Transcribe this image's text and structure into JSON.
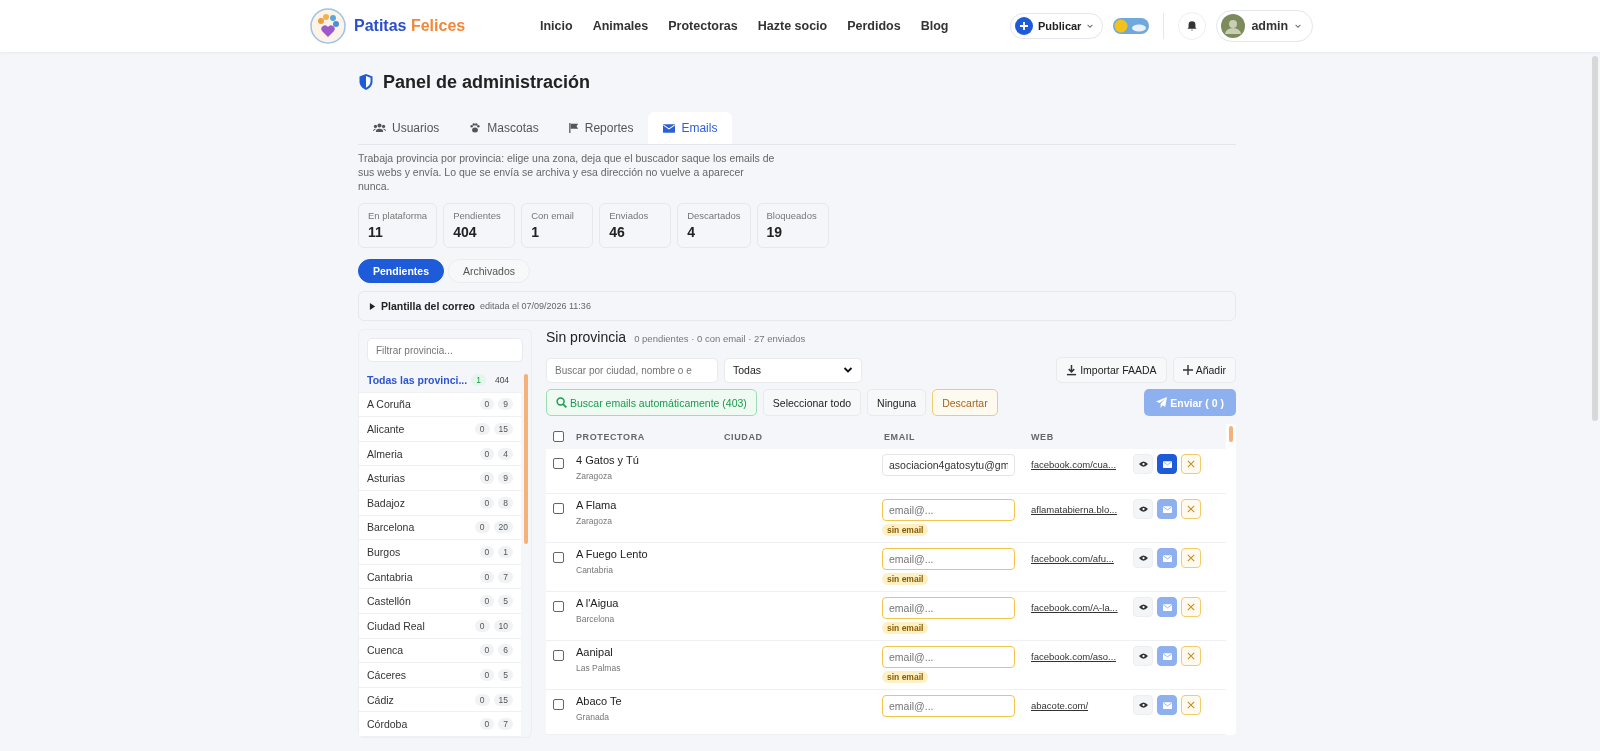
{
  "brand": {
    "first": "Patitas",
    "second": "Felices"
  },
  "nav": [
    "Inicio",
    "Animales",
    "Protectoras",
    "Hazte socio",
    "Perdidos",
    "Blog"
  ],
  "header_actions": {
    "publish": "Publicar",
    "user": "admin"
  },
  "page_title": "Panel de administración",
  "tabs": [
    {
      "label": "Usuarios",
      "kind": "users",
      "selected": false
    },
    {
      "label": "Mascotas",
      "kind": "pets",
      "selected": false
    },
    {
      "label": "Reportes",
      "kind": "reports",
      "selected": false
    },
    {
      "label": "Emails",
      "kind": "emails",
      "selected": true
    }
  ],
  "description": "Trabaja provincia por provincia: elige una zona, deja que el buscador saque los emails de sus webs y envía. Lo que se envía se archiva y esa dirección no vuelve a aparecer nunca.",
  "stats": [
    {
      "label": "En plataforma",
      "value": "11"
    },
    {
      "label": "Pendientes",
      "value": "404"
    },
    {
      "label": "Con email",
      "value": "1"
    },
    {
      "label": "Enviados",
      "value": "46"
    },
    {
      "label": "Descartados",
      "value": "4"
    },
    {
      "label": "Bloqueados",
      "value": "19"
    }
  ],
  "sub_tabs": [
    {
      "label": "Pendientes",
      "selected": true
    },
    {
      "label": "Archivados",
      "selected": false
    }
  ],
  "template": {
    "title": "Plantilla del correo",
    "meta": "editada el 07/09/2026 11:36"
  },
  "sidebar": {
    "filter_placeholder": "Filtrar provincia...",
    "items": [
      {
        "name": "Todas las provinci...",
        "with_email": "1",
        "pending": "404",
        "selected": true
      },
      {
        "name": "A Coruña",
        "with_email": "0",
        "pending": "9",
        "selected": false
      },
      {
        "name": "Alicante",
        "with_email": "0",
        "pending": "15",
        "selected": false
      },
      {
        "name": "Almeria",
        "with_email": "0",
        "pending": "4",
        "selected": false
      },
      {
        "name": "Asturias",
        "with_email": "0",
        "pending": "9",
        "selected": false
      },
      {
        "name": "Badajoz",
        "with_email": "0",
        "pending": "8",
        "selected": false
      },
      {
        "name": "Barcelona",
        "with_email": "0",
        "pending": "20",
        "selected": false
      },
      {
        "name": "Burgos",
        "with_email": "0",
        "pending": "1",
        "selected": false
      },
      {
        "name": "Cantabria",
        "with_email": "0",
        "pending": "7",
        "selected": false
      },
      {
        "name": "Castellón",
        "with_email": "0",
        "pending": "5",
        "selected": false
      },
      {
        "name": "Ciudad Real",
        "with_email": "0",
        "pending": "10",
        "selected": false
      },
      {
        "name": "Cuenca",
        "with_email": "0",
        "pending": "6",
        "selected": false
      },
      {
        "name": "Cáceres",
        "with_email": "0",
        "pending": "5",
        "selected": false
      },
      {
        "name": "Cádiz",
        "with_email": "0",
        "pending": "15",
        "selected": false
      },
      {
        "name": "Córdoba",
        "with_email": "0",
        "pending": "7",
        "selected": false
      }
    ]
  },
  "main": {
    "title": "Sin provincia",
    "summary": "0 pendientes · 0 con email · 27 enviados",
    "search_placeholder": "Buscar por ciudad, nombre o e",
    "filter_value": "Todas",
    "import_button": "Importar FAADA",
    "add_button": "Añadir",
    "auto_search_button": "Buscar emails automáticamente (403)",
    "select_all_button": "Seleccionar todo",
    "none_button": "Ninguna",
    "discard_button": "Descartar",
    "send_button": {
      "label": "Enviar ( 0 )",
      "disabled": true
    }
  },
  "table": {
    "columns": [
      "PROTECTORA",
      "CIUDAD",
      "EMAIL",
      "WEB"
    ],
    "all_checked": false,
    "rows": [
      {
        "name": "4 Gatos y Tú",
        "province": "Zaragoza",
        "email": "asociacion4gatosytu@gm",
        "badge": null,
        "web": "facebook.com/cua...",
        "checked": false,
        "send_enabled": true
      },
      {
        "name": "A Flama",
        "province": "Zaragoza",
        "email": "",
        "email_placeholder": "email@...",
        "badge": "sin email",
        "web": "aflamatabierna.blo...",
        "checked": false,
        "send_enabled": false
      },
      {
        "name": "A Fuego Lento",
        "province": "Cantabria",
        "email": "",
        "email_placeholder": "email@...",
        "badge": "sin email",
        "web": "facebook.com/afu...",
        "checked": false,
        "send_enabled": false
      },
      {
        "name": "A l'Aigua",
        "province": "Barcelona",
        "email": "",
        "email_placeholder": "email@...",
        "badge": "sin email",
        "web": "facebook.com/A-la...",
        "checked": false,
        "send_enabled": false
      },
      {
        "name": "Aanipal",
        "province": "Las Palmas",
        "email": "",
        "email_placeholder": "email@...",
        "badge": "sin email",
        "web": "facebook.com/aso...",
        "checked": false,
        "send_enabled": false
      },
      {
        "name": "Abaco Te",
        "province": "Granada",
        "email": "",
        "email_placeholder": "email@...",
        "badge": null,
        "web": "abacote.com/",
        "checked": false,
        "send_enabled": false
      }
    ]
  }
}
